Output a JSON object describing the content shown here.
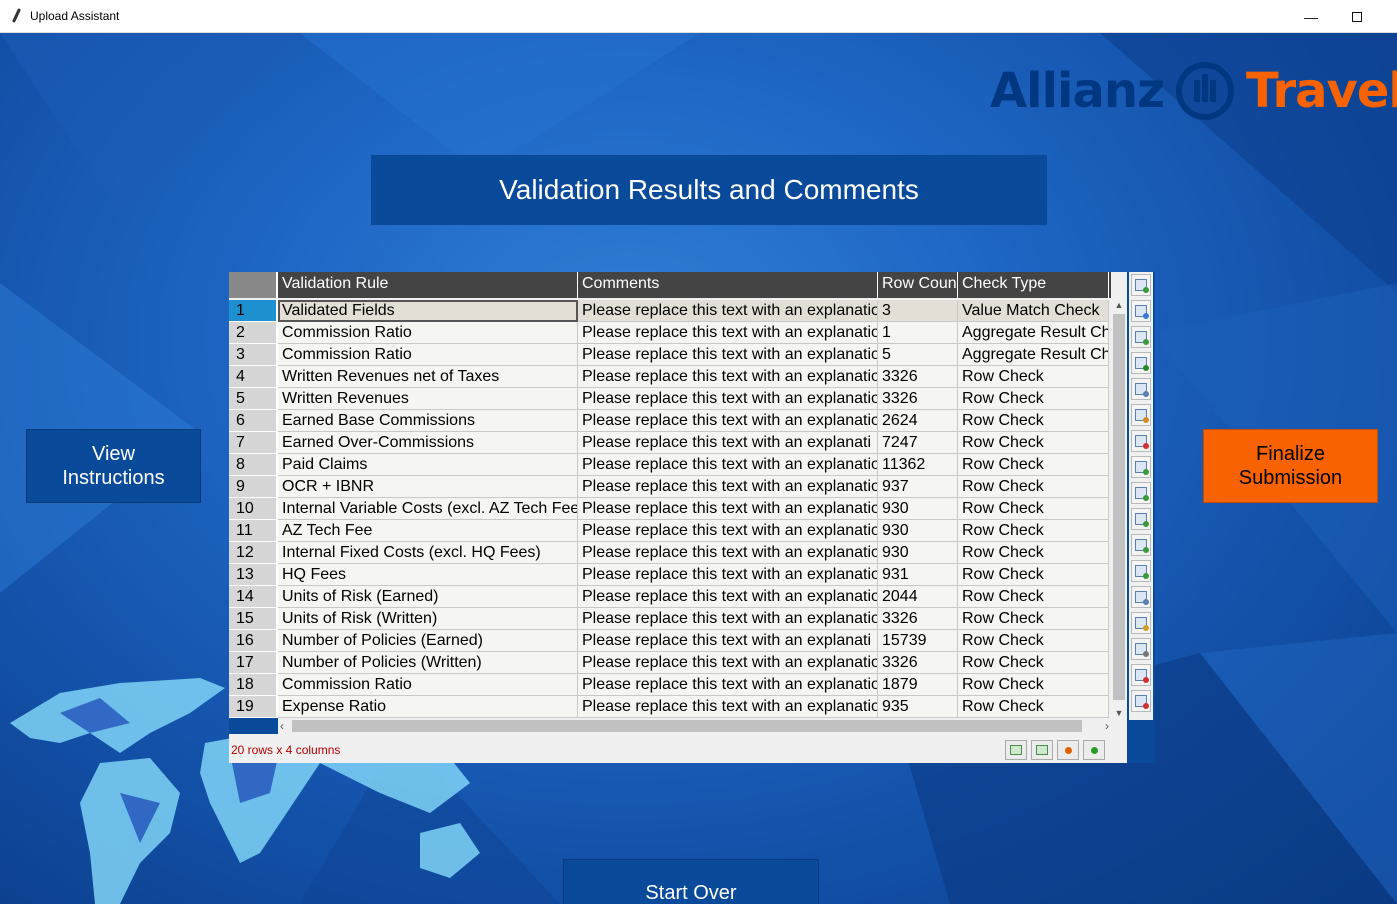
{
  "window": {
    "title": "Upload Assistant",
    "min_label": "—",
    "close_label": ""
  },
  "logo": {
    "left": "Allianz",
    "right": "Travel"
  },
  "banner": "Validation Results and Comments",
  "buttons": {
    "view_line1": "View",
    "view_line2": "Instructions",
    "finalize_line1": "Finalize",
    "finalize_line2": "Submission",
    "start_over": "Start Over"
  },
  "table": {
    "columns": [
      "Validation Rule",
      "Comments",
      "Row Coun",
      "Check Type"
    ],
    "rows": [
      [
        "1",
        "Validated Fields",
        "Please replace this text with an explanatio",
        "3",
        "Value Match Check"
      ],
      [
        "2",
        "Commission Ratio",
        "Please replace this text with an explanatio",
        "1",
        "Aggregate Result Ch"
      ],
      [
        "3",
        "Commission Ratio",
        "Please replace this text with an explanatio",
        "5",
        "Aggregate Result Ch"
      ],
      [
        "4",
        "Written Revenues net of Taxes",
        "Please replace this text with an explanatio",
        "3326",
        "Row Check"
      ],
      [
        "5",
        "Written Revenues",
        "Please replace this text with an explanatio",
        "3326",
        "Row Check"
      ],
      [
        "6",
        "Earned Base Commissions",
        "Please replace this text with an explanatio",
        "2624",
        "Row Check"
      ],
      [
        "7",
        "Earned Over-Commissions",
        "Please replace this text with an explanati",
        "7247",
        "Row Check"
      ],
      [
        "8",
        "Paid Claims",
        "Please replace this text with an explanatio",
        "11362",
        "Row Check"
      ],
      [
        "9",
        "OCR + IBNR",
        "Please replace this text with an explanatio",
        "937",
        "Row Check"
      ],
      [
        "10",
        "Internal Variable Costs (excl. AZ Tech Fee",
        "Please replace this text with an explanatio",
        "930",
        "Row Check"
      ],
      [
        "11",
        "AZ Tech Fee",
        "Please replace this text with an explanatio",
        "930",
        "Row Check"
      ],
      [
        "12",
        "Internal Fixed Costs (excl. HQ Fees)",
        "Please replace this text with an explanatio",
        "930",
        "Row Check"
      ],
      [
        "13",
        "HQ Fees",
        "Please replace this text with an explanatio",
        "931",
        "Row Check"
      ],
      [
        "14",
        "Units of Risk (Earned)",
        "Please replace this text with an explanatio",
        "2044",
        "Row Check"
      ],
      [
        "15",
        "Units of Risk (Written)",
        "Please replace this text with an explanatio",
        "3326",
        "Row Check"
      ],
      [
        "16",
        "Number of Policies (Earned)",
        "Please replace this text with an explanati",
        "15739",
        "Row Check"
      ],
      [
        "17",
        "Number of Policies (Written)",
        "Please replace this text with an explanatio",
        "3326",
        "Row Check"
      ],
      [
        "18",
        "Commission Ratio",
        "Please replace this text with an explanatio",
        "1879",
        "Row Check"
      ],
      [
        "19",
        "Expense Ratio",
        "Please replace this text with an explanatio",
        "935",
        "Row Check"
      ]
    ],
    "status": "20 rows x 4 columns",
    "selected_row": 1
  },
  "toolbar_icons": [
    "save-icon",
    "copy-table-icon",
    "import-icon",
    "excel-icon",
    "copy-icon",
    "paste-icon",
    "plot-icon",
    "refresh-icon",
    "forward-icon",
    "return-icon",
    "share-icon",
    "chart-icon",
    "duplicate-icon",
    "edit-icon",
    "calculator-icon",
    "graph-icon",
    "settings-icon"
  ],
  "status_icons": [
    "prev-page-icon",
    "next-page-icon",
    "remove-icon",
    "add-icon"
  ],
  "colors": {
    "brand_blue": "#003781",
    "brand_orange": "#f86200",
    "panel_blue": "#0a4a9b",
    "status_red": "#b00000"
  }
}
